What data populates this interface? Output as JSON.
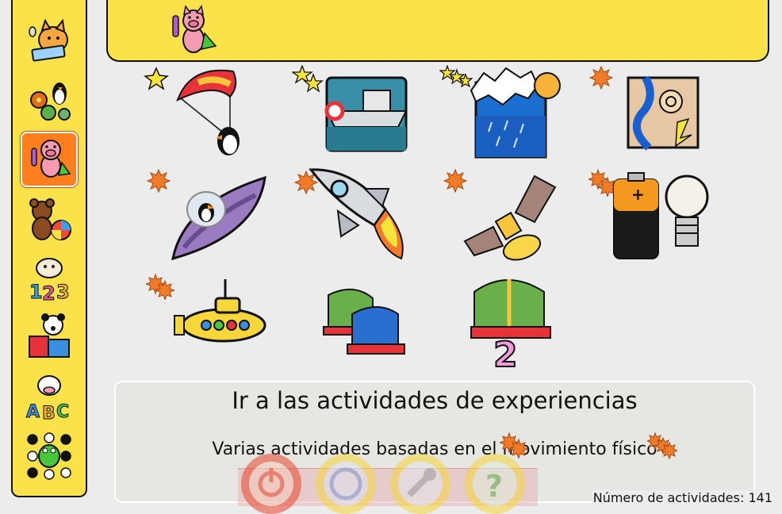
{
  "sidebar": {
    "items": [
      {
        "icon": "cat-keyboard-icon",
        "active": false
      },
      {
        "icon": "penguin-gears-icon",
        "active": false
      },
      {
        "icon": "pig-experiments-icon",
        "active": true
      },
      {
        "icon": "teddy-ball-icon",
        "active": false
      },
      {
        "icon": "sheep-123-icon",
        "active": false
      },
      {
        "icon": "dog-puzzle-icon",
        "active": false
      },
      {
        "icon": "cow-abc-icon",
        "active": false
      },
      {
        "icon": "frog-board-icon",
        "active": false
      }
    ]
  },
  "header": {
    "icon": "pig-experiments-icon"
  },
  "activities": [
    {
      "icon": "parachute-penguin-icon",
      "level": "star-1"
    },
    {
      "icon": "boat-lock-icon",
      "level": "star-2"
    },
    {
      "icon": "water-cycle-icon",
      "level": "star-3"
    },
    {
      "icon": "river-map-icon",
      "level": "flower-1"
    },
    {
      "icon": "ufo-penguin-icon",
      "level": "flower-1"
    },
    {
      "icon": "rocket-icon",
      "level": "flower-1"
    },
    {
      "icon": "satellite-icon",
      "level": "flower-1"
    },
    {
      "icon": "battery-bulb-icon",
      "level": "flower-2"
    },
    {
      "icon": "submarine-icon",
      "level": "flower-2"
    },
    {
      "icon": "two-sailboats-icon",
      "level": "none"
    },
    {
      "icon": "sailboat-two-icon",
      "level": "none"
    }
  ],
  "description": {
    "title": "Ir a las actividades de experiencias",
    "text": "Varias actividades basadas en el movimiento físico"
  },
  "controls": [
    {
      "icon": "exit-icon",
      "color": "#e8452e"
    },
    {
      "icon": "gcompris-logo-icon",
      "color": "#7e9bd6"
    },
    {
      "icon": "wrench-icon",
      "color": "#9aa0a8"
    },
    {
      "icon": "help-icon",
      "color": "#5ab04a"
    }
  ],
  "status": {
    "activity_count": "Número de actividades: 141"
  },
  "colors": {
    "yellow": "#fbe14a",
    "active": "#ff7f1f",
    "star": "#f7e53b",
    "flower": "#f07c2a"
  }
}
